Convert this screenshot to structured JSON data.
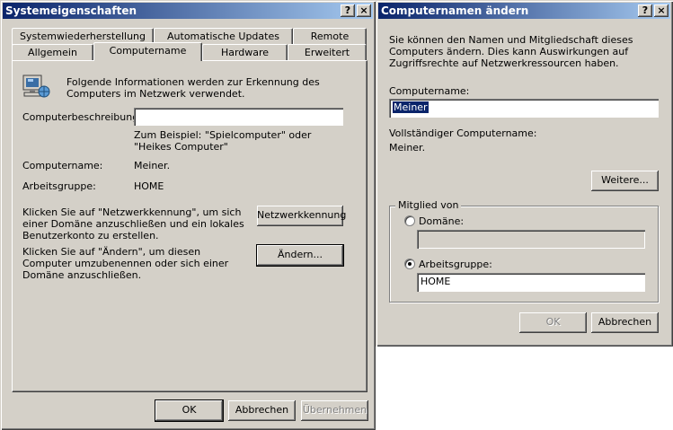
{
  "sysprops": {
    "title": "Systemeigenschaften",
    "help_btn": "?",
    "close_btn": "×",
    "tabs_back": [
      "Systemwiederherstellung",
      "Automatische Updates",
      "Remote"
    ],
    "tabs_front": [
      "Allgemein",
      "Computername",
      "Hardware",
      "Erweitert"
    ],
    "intro": "Folgende Informationen werden zur Erkennung des Computers im Netzwerk verwendet.",
    "desc_label": "Computerbeschreibung:",
    "desc_value": "",
    "example": "Zum Beispiel: \"Spielcomputer\" oder \"Heikes Computer\"",
    "computername_label": "Computername:",
    "computername_value": "Meiner.",
    "workgroup_label": "Arbeitsgruppe:",
    "workgroup_value": "HOME",
    "network_text": "Klicken Sie auf \"Netzwerkkennung\", um sich einer Domäne anzuschließen und ein lokales Benutzerkonto zu erstellen.",
    "network_button": "Netzwerkkennung",
    "change_text": "Klicken Sie auf \"Ändern\", um diesen Computer umzubenennen oder sich einer Domäne anzuschließen.",
    "change_button": "Ändern...",
    "ok": "OK",
    "cancel": "Abbrechen",
    "apply": "Übernehmen"
  },
  "rename": {
    "title": "Computernamen ändern",
    "help_btn": "?",
    "close_btn": "×",
    "intro": "Sie können den Namen und Mitgliedschaft dieses Computers ändern. Dies kann Auswirkungen auf Zugriffsrechte auf Netzwerkressourcen haben.",
    "name_label": "Computername:",
    "name_value": "Meiner",
    "full_label": "Vollständiger Computername:",
    "full_value": "Meiner.",
    "more_button": "Weitere...",
    "member_group": "Mitglied von",
    "domain_label": "Domäne:",
    "domain_value": "",
    "workgroup_label": "Arbeitsgruppe:",
    "workgroup_value": "HOME",
    "selected_option": "Arbeitsgruppe",
    "ok": "OK",
    "cancel": "Abbrechen"
  },
  "colors": {
    "title_start": "#0a246a",
    "title_end": "#a6caf0",
    "face": "#d4d0c8"
  }
}
